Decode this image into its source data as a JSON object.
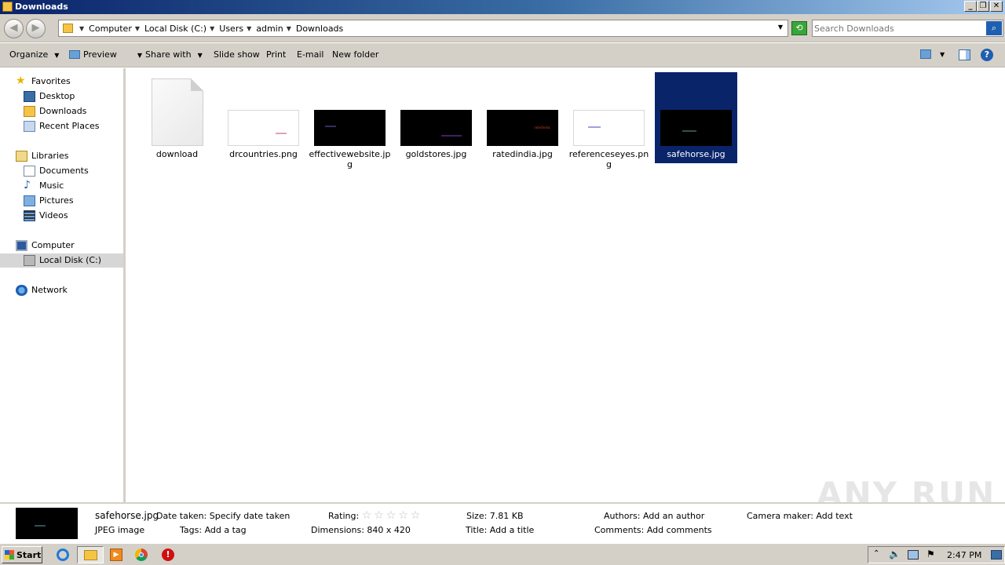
{
  "window": {
    "title": "Downloads",
    "controls": {
      "minimize": "_",
      "restore": "❐",
      "close": "✕"
    }
  },
  "address": {
    "breadcrumbs": [
      "Computer",
      "Local Disk (C:)",
      "Users",
      "admin",
      "Downloads"
    ],
    "search_placeholder": "Search Downloads"
  },
  "toolbar": {
    "organize": "Organize",
    "preview": "Preview",
    "share_with": "Share with",
    "slide_show": "Slide show",
    "print": "Print",
    "email": "E-mail",
    "new_folder": "New folder"
  },
  "nav": {
    "favorites": "Favorites",
    "desktop": "Desktop",
    "downloads": "Downloads",
    "recent_places": "Recent Places",
    "libraries": "Libraries",
    "documents": "Documents",
    "music": "Music",
    "pictures": "Pictures",
    "videos": "Videos",
    "computer": "Computer",
    "local_disk": "Local Disk (C:)",
    "network": "Network"
  },
  "files": [
    {
      "name": "download",
      "kind": "generic"
    },
    {
      "name": "drcountries.png",
      "kind": "image",
      "bg": "#ffffff",
      "accent": "#e0a0c0"
    },
    {
      "name": "effectivewebsite.jpg",
      "kind": "image",
      "bg": "#000000",
      "accent": "#303060"
    },
    {
      "name": "goldstores.jpg",
      "kind": "image",
      "bg": "#000000",
      "accent": "#402060"
    },
    {
      "name": "ratedindia.jpg",
      "kind": "image",
      "bg": "#000000",
      "accent": "#c04020",
      "thumb_text": "ratedindia"
    },
    {
      "name": "referenceseyes.png",
      "kind": "image",
      "bg": "#ffffff",
      "accent": "#a0a0e0"
    },
    {
      "name": "safehorse.jpg",
      "kind": "image",
      "bg": "#000000",
      "accent": "#305050",
      "selected": true
    }
  ],
  "details": {
    "filename": "safehorse.jpg",
    "filetype": "JPEG image",
    "date_taken_label": "Date taken:",
    "date_taken_value": "Specify date taken",
    "tags_label": "Tags:",
    "tags_value": "Add a tag",
    "rating_label": "Rating:",
    "rating_value": 0,
    "dimensions_label": "Dimensions:",
    "dimensions_value": "840 x 420",
    "size_label": "Size:",
    "size_value": "7.81 KB",
    "title_label": "Title:",
    "title_value": "Add a title",
    "authors_label": "Authors:",
    "authors_value": "Add an author",
    "comments_label": "Comments:",
    "comments_value": "Add comments",
    "camera_label": "Camera maker:",
    "camera_value": "Add text"
  },
  "watermark": "ANY RUN",
  "taskbar": {
    "start": "Start",
    "clock": "2:47 PM"
  }
}
